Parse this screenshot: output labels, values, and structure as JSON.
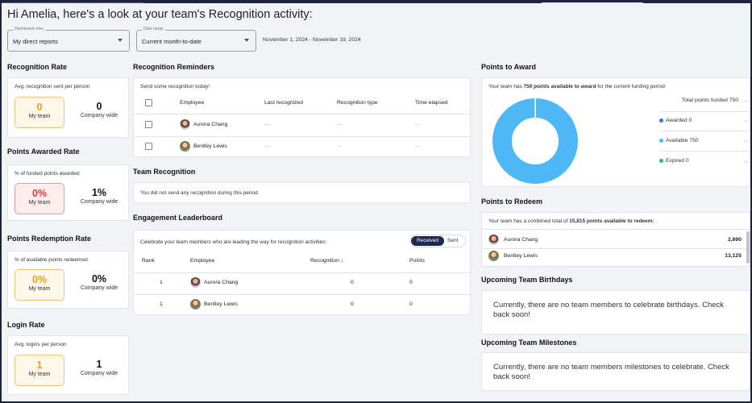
{
  "header": {
    "greeting": "Hi Amelia, here's a look at your team's Recognition activity:",
    "dashboard_view": {
      "legend": "Dashboard view",
      "value": "My direct reports"
    },
    "date_range": {
      "legend": "Date range",
      "value": "Current month-to-date"
    },
    "date_span": "November 1, 2024 - November 19, 2024"
  },
  "recognition_rate": {
    "title": "Recognition Rate",
    "subtitle": "Avg. recognition sent per person",
    "my_team_value": "0",
    "my_team_label": "My team",
    "company_value": "0",
    "company_label": "Company wide"
  },
  "points_awarded_rate": {
    "title": "Points Awarded Rate",
    "subtitle": "% of funded points awarded",
    "my_team_value": "0%",
    "my_team_label": "My team",
    "company_value": "1%",
    "company_label": "Company wide"
  },
  "points_redemption_rate": {
    "title": "Points Redemption Rate",
    "subtitle": "% of available points redeemed",
    "my_team_value": "0%",
    "my_team_label": "My team",
    "company_value": "0%",
    "company_label": "Company wide"
  },
  "login_rate": {
    "title": "Login Rate",
    "subtitle": "Avg. logins per person",
    "my_team_value": "1",
    "my_team_label": "My team",
    "company_value": "1",
    "company_label": "Company wide"
  },
  "reminders": {
    "title": "Recognition Reminders",
    "prompt": "Send some recognition today!",
    "columns": [
      "Employee",
      "Last recognized",
      "Recognition type",
      "Time elapsed"
    ],
    "rows": [
      {
        "name": "Aurora Chang",
        "last": "---",
        "type": "---",
        "elapsed": "---"
      },
      {
        "name": "Bentley Lewis",
        "last": "---",
        "type": "---",
        "elapsed": "---"
      }
    ]
  },
  "team_recognition": {
    "title": "Team Recognition",
    "message": "You did not send any recognition during this period."
  },
  "leaderboard": {
    "title": "Engagement Leaderboard",
    "prompt": "Celebrate your team members who are leading the way for recognition activities:",
    "toggle_received": "Received",
    "toggle_sent": "Sent",
    "columns": {
      "rank": "Rank",
      "employee": "Employee",
      "recognition": "Recognition ↓",
      "points": "Points"
    },
    "rows": [
      {
        "rank": "1",
        "name": "Aurora Chang",
        "recognition": "0",
        "points": "0"
      },
      {
        "rank": "1",
        "name": "Bentley Lewis",
        "recognition": "0",
        "points": "0"
      }
    ]
  },
  "points_to_award": {
    "title": "Points to Award",
    "summary_prefix": "Your team has ",
    "summary_bold": "750 points available to award",
    "summary_suffix": " for the current funding period:",
    "total": "Total points funded 750",
    "awarded": "Awarded 0",
    "available": "Available 750",
    "expired": "Expired 0",
    "colors": {
      "available": "#4db8f5",
      "awarded": "#2d7be0",
      "expired": "#27b38a"
    }
  },
  "points_to_redeem": {
    "title": "Points to Redeem",
    "summary_prefix": "Your team has a combined total of ",
    "summary_bold": "15,815 points available to redeem:",
    "rows": [
      {
        "name": "Aurora Chang",
        "points": "2,690"
      },
      {
        "name": "Bentley Lewis",
        "points": "13,125"
      }
    ]
  },
  "birthdays": {
    "title": "Upcoming Team Birthdays",
    "message": "Currently, there are no team members to celebrate birthdays. Check back soon!"
  },
  "milestones": {
    "title": "Upcoming Team Milestones",
    "message": "Currently, there are no team members milestones to celebrate. Check back soon!"
  }
}
